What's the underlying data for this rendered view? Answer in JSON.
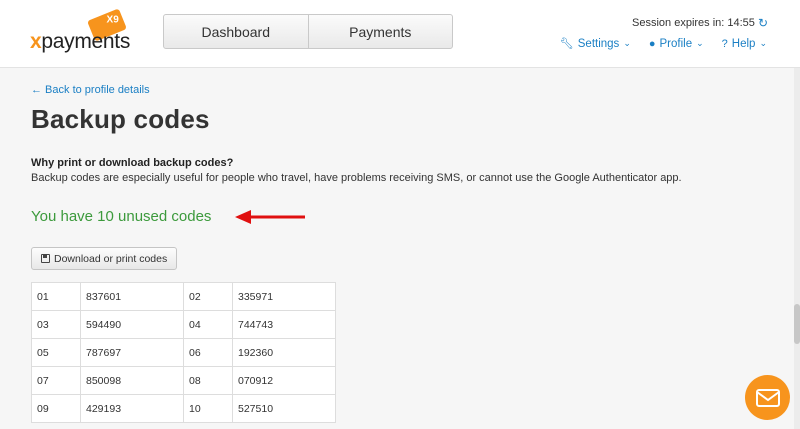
{
  "header": {
    "logo": {
      "text_x": "x",
      "text_rest": "payments",
      "badge": "X9"
    },
    "nav": {
      "tabs": [
        {
          "label": "Dashboard"
        },
        {
          "label": "Payments"
        }
      ]
    },
    "session": {
      "label": "Session expires in: 14:55",
      "refresh_icon": "refresh-icon"
    },
    "menu": {
      "settings": "Settings",
      "profile": "Profile",
      "help": "Help"
    }
  },
  "page": {
    "back_link": "← Back to profile details",
    "title": "Backup codes",
    "why_title": "Why print or download backup codes?",
    "why_desc": "Backup codes are especially useful for people who travel, have problems receiving SMS, or cannot use the Google Authenticator app.",
    "unused_text": "You have 10 unused codes",
    "download_button": "Download or print codes"
  },
  "codes": [
    {
      "n1": "01",
      "c1": "837601",
      "n2": "02",
      "c2": "335971"
    },
    {
      "n1": "03",
      "c1": "594490",
      "n2": "04",
      "c2": "744743"
    },
    {
      "n1": "05",
      "c1": "787697",
      "n2": "06",
      "c2": "192360"
    },
    {
      "n1": "07",
      "c1": "850098",
      "n2": "08",
      "c2": "070912"
    },
    {
      "n1": "09",
      "c1": "429193",
      "n2": "10",
      "c2": "527510"
    }
  ],
  "colors": {
    "accent": "#1a7fc4",
    "brand": "#f7941d",
    "success": "#3c9a3c",
    "annotation_arrow": "#e01010"
  }
}
